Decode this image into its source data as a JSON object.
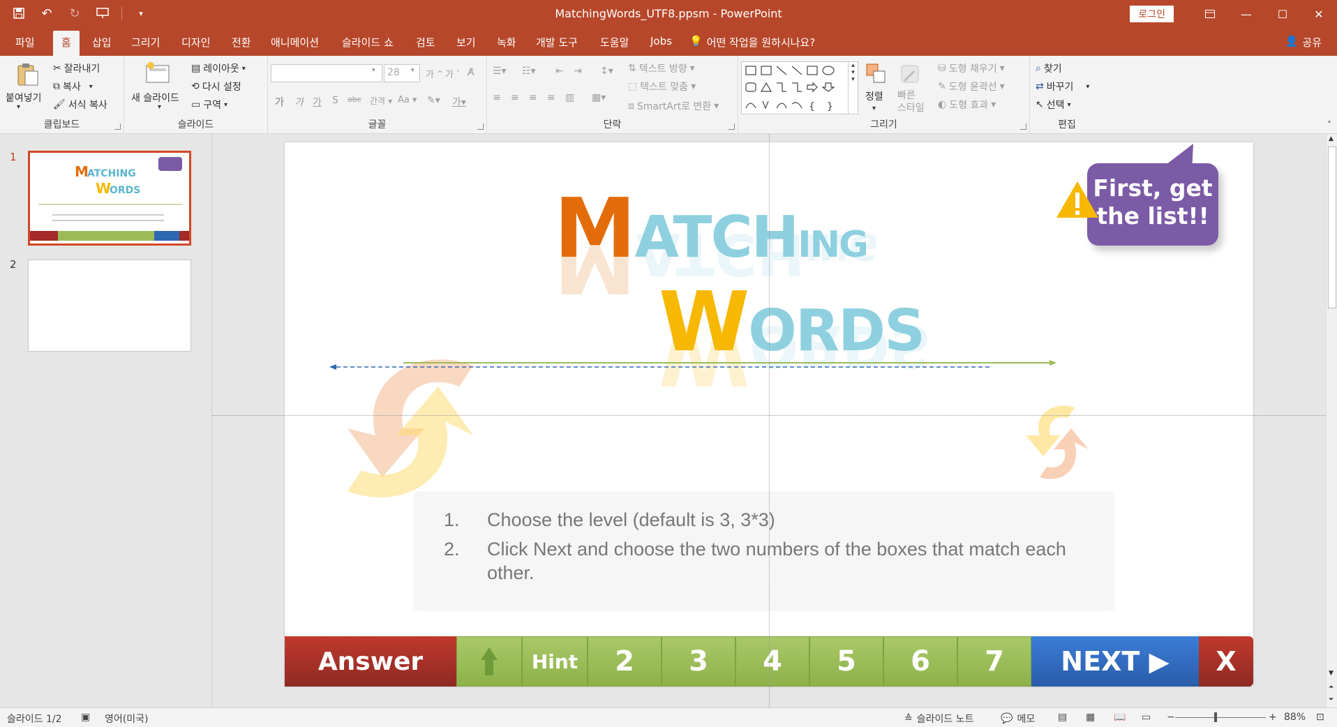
{
  "window": {
    "title": "MatchingWords_UTF8.ppsm  -  PowerPoint",
    "login": "로그인"
  },
  "qat": {
    "icons": [
      "save-icon",
      "undo-icon",
      "redo-icon",
      "present-icon",
      "customize-icon"
    ]
  },
  "tabs": [
    "파일",
    "홈",
    "삽입",
    "그리기",
    "디자인",
    "전환",
    "애니메이션",
    "슬라이드 쇼",
    "검토",
    "보기",
    "녹화",
    "개발 도구",
    "도움말",
    "Jobs"
  ],
  "active_tab": "홈",
  "tellme": "어떤 작업을 원하시나요?",
  "share": "공유",
  "ribbon": {
    "clipboard": {
      "label": "클립보드",
      "paste": "붙여넣기",
      "cut": "잘라내기",
      "copy": "복사",
      "format_painter": "서식 복사"
    },
    "slides": {
      "label": "슬라이드",
      "new_slide": "새 슬라이드",
      "layout": "레이아웃",
      "reset": "다시 설정",
      "section": "구역"
    },
    "font": {
      "label": "글꼴",
      "font_name": "",
      "font_size": "28",
      "bold": "가",
      "italic": "가",
      "underline": "가",
      "shadow": "S",
      "strike": "abc",
      "spacing": "간격",
      "case": "Aa"
    },
    "paragraph": {
      "label": "단락",
      "text_direction": "텍스트 방향",
      "align_text": "텍스트 맞춤",
      "smartart": "SmartArt로 변환"
    },
    "drawing": {
      "label": "그리기",
      "arrange": "정렬",
      "quick_styles": "빠른\n스타일",
      "fill": "도형 채우기",
      "outline": "도형 윤곽선",
      "effects": "도형 효과"
    },
    "editing": {
      "label": "편집",
      "find": "찾기",
      "replace": "바꾸기",
      "select": "선택"
    }
  },
  "thumbnails": [
    {
      "number": "1",
      "selected": true
    },
    {
      "number": "2",
      "selected": false
    }
  ],
  "slide": {
    "title_line1": {
      "first": "M",
      "rest": "ATCH",
      "small": "ING"
    },
    "title_line2": {
      "first": "W",
      "rest": "ORDS"
    },
    "callout": "First, get\nthe list!!",
    "instructions": [
      {
        "num": "1.",
        "text": "Choose the level (default is 3, 3*3)"
      },
      {
        "num": "2.",
        "text": "Click Next and choose the two numbers of the boxes that match each"
      },
      {
        "num": "",
        "text": "other."
      }
    ],
    "nav": {
      "answer": "Answer",
      "home_icon": "home-icon",
      "hint": "Hint",
      "numbers": [
        "2",
        "3",
        "4",
        "5",
        "6",
        "7"
      ],
      "next": "NEXT ▶",
      "close": "X"
    },
    "colors": {
      "orange": "#e36c0a",
      "blue": "#5bb4cf",
      "yellow": "#f6b800",
      "purple": "#7b5aa6",
      "green": "#9bbb59",
      "red": "#a52a2a",
      "next_blue": "#2e67b1"
    }
  },
  "status": {
    "slide_info": "슬라이드 1/2",
    "language": "영어(미국)",
    "notes": "슬라이드 노트",
    "comments": "메모",
    "zoom": "88%"
  }
}
